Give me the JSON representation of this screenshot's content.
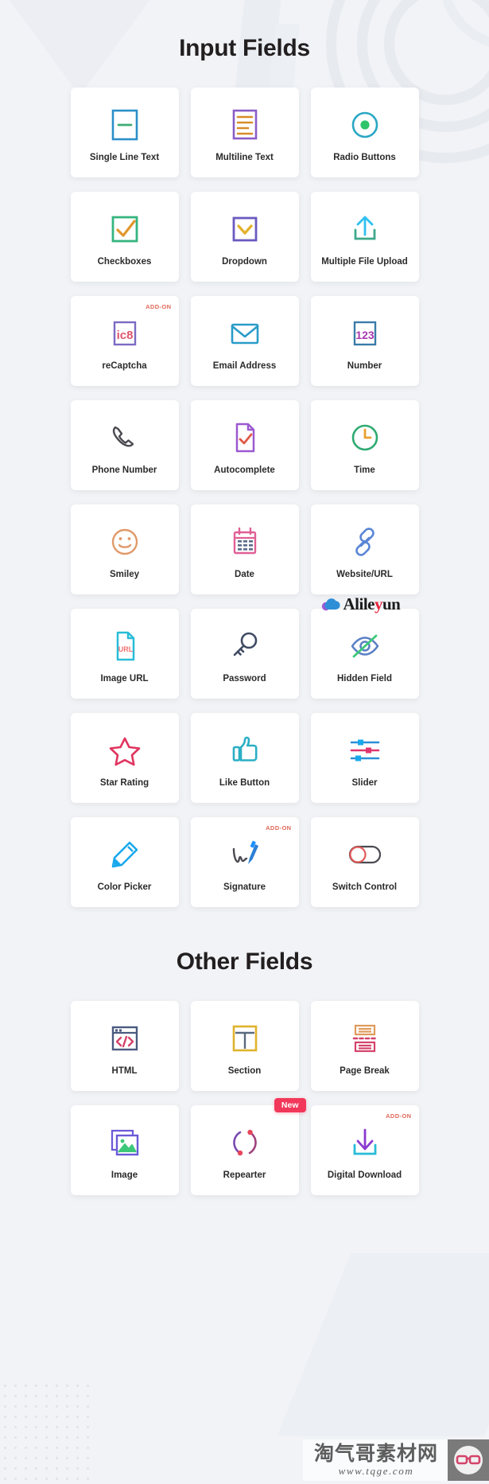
{
  "sections": [
    {
      "title": "Input Fields",
      "cards": [
        {
          "label": "Single Line Text",
          "icon": "single-line-text-icon",
          "badge": null
        },
        {
          "label": "Multiline Text",
          "icon": "multiline-text-icon",
          "badge": null
        },
        {
          "label": "Radio Buttons",
          "icon": "radio-buttons-icon",
          "badge": null
        },
        {
          "label": "Checkboxes",
          "icon": "checkbox-icon",
          "badge": null
        },
        {
          "label": "Dropdown",
          "icon": "dropdown-icon",
          "badge": null
        },
        {
          "label": "Multiple File Upload",
          "icon": "file-upload-icon",
          "badge": null
        },
        {
          "label": "reCaptcha",
          "icon": "recaptcha-icon",
          "badge": "ADD-ON",
          "icon_text": "ic8"
        },
        {
          "label": "Email Address",
          "icon": "envelope-icon",
          "badge": null
        },
        {
          "label": "Number",
          "icon": "number-icon",
          "badge": null,
          "icon_text": "123"
        },
        {
          "label": "Phone Number",
          "icon": "phone-icon",
          "badge": null
        },
        {
          "label": "Autocomplete",
          "icon": "autocomplete-doc-icon",
          "badge": null
        },
        {
          "label": "Time",
          "icon": "clock-icon",
          "badge": null
        },
        {
          "label": "Smiley",
          "icon": "smiley-icon",
          "badge": null
        },
        {
          "label": "Date",
          "icon": "calendar-icon",
          "badge": null
        },
        {
          "label": "Website/URL",
          "icon": "link-chain-icon",
          "badge": null
        },
        {
          "label": "Image URL",
          "icon": "image-url-doc-icon",
          "badge": null,
          "icon_text": "URL"
        },
        {
          "label": "Password",
          "icon": "key-icon",
          "badge": null
        },
        {
          "label": "Hidden Field",
          "icon": "eye-slash-icon",
          "badge": null,
          "watermark": "Alileyun"
        },
        {
          "label": "Star Rating",
          "icon": "star-icon",
          "badge": null
        },
        {
          "label": "Like Button",
          "icon": "thumbs-up-icon",
          "badge": null
        },
        {
          "label": "Slider",
          "icon": "slider-icon",
          "badge": null
        },
        {
          "label": "Color Picker",
          "icon": "pen-color-picker-icon",
          "badge": null
        },
        {
          "label": "Signature",
          "icon": "signature-icon",
          "badge": "ADD-ON"
        },
        {
          "label": "Switch Control",
          "icon": "toggle-switch-icon",
          "badge": null
        }
      ]
    },
    {
      "title": "Other Fields",
      "cards": [
        {
          "label": "HTML",
          "icon": "code-window-icon",
          "badge": null
        },
        {
          "label": "Section",
          "icon": "section-layout-icon",
          "badge": null
        },
        {
          "label": "Page Break",
          "icon": "page-break-icon",
          "badge": null
        },
        {
          "label": "Image",
          "icon": "image-stack-icon",
          "badge": null
        },
        {
          "label": "Repearter",
          "icon": "repeat-cycle-icon",
          "badge": "New"
        },
        {
          "label": "Digital Download",
          "icon": "download-icon",
          "badge": "ADD-ON"
        }
      ]
    }
  ],
  "watermark": {
    "brand_prefix": "Alile",
    "brand_accent": "y",
    "brand_suffix": "un",
    "footer_cn": "淘气哥素材网",
    "footer_url": "www.tqge.com"
  },
  "colors": {
    "page_bg": "#f1f3f6",
    "card_bg": "#ffffff",
    "title": "#231f20",
    "addon": "#e06a5a",
    "new_badge": "#f2385a"
  }
}
